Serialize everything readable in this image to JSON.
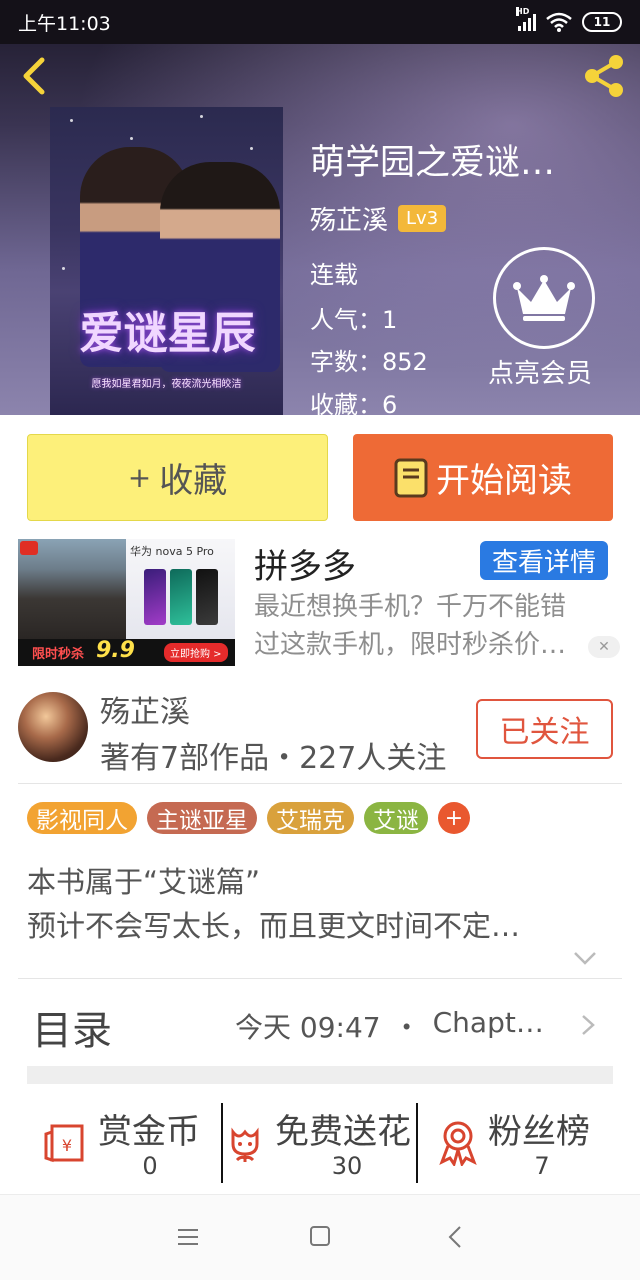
{
  "status_bar": {
    "time": "上午11:03",
    "network": "HD",
    "battery": "11"
  },
  "book": {
    "title": "萌学园之爱谜…",
    "author": "殇芷溪",
    "level": "Lv3",
    "status": "连载",
    "popularity": "人气：1",
    "word_count": "字数：852",
    "favorites": "收藏：6",
    "cover_title": "爱谜星辰",
    "cover_subtitle": "愿我如星君如月，夜夜流光相皎洁"
  },
  "vip": {
    "label": "点亮会员"
  },
  "actions": {
    "favorite_plus": "+",
    "favorite_label": "收藏",
    "read_label": "开始阅读"
  },
  "ad": {
    "title": "拼多多",
    "detail_button": "查看详情",
    "line1": "最近想换手机？千万不能错",
    "line2": "过这款手机，限时秒杀价…",
    "close": "✕",
    "image_brand": "华为 nova 5 Pro",
    "image_sale": "限时秒杀",
    "image_price": "9.9",
    "image_buy": "立即抢购 >"
  },
  "author": {
    "name": "殇芷溪",
    "stats": "著有7部作品・227人关注",
    "follow_label": "已关注"
  },
  "tags": [
    {
      "label": "影视同人",
      "color": "#f2a332"
    },
    {
      "label": "主谜亚星",
      "color": "#c56a52"
    },
    {
      "label": "艾瑞克",
      "color": "#d9a13c"
    },
    {
      "label": "艾谜",
      "color": "#8bb542"
    }
  ],
  "tag_more": "+",
  "intro": {
    "line1": "本书属于“艾谜篇”",
    "line2": "预计不会写太长，而且更文时间不定…"
  },
  "catalog": {
    "label": "目录",
    "updated": "今天 09:47",
    "dot": "・",
    "latest": "Chapt…"
  },
  "stats": [
    {
      "label": "赏金币",
      "value": "0",
      "icon": "red-envelope-icon"
    },
    {
      "label": "免费送花",
      "value": "30",
      "icon": "flower-icon"
    },
    {
      "label": "粉丝榜",
      "value": "7",
      "icon": "medal-icon"
    }
  ],
  "colors": {
    "favorite_button": "#fdf07a",
    "read_button": "#ee6a36",
    "follow_accent": "#e0553e",
    "ad_button": "#2a7ae2",
    "lv_badge": "#f3b83a",
    "icon_red": "#d8452f"
  }
}
